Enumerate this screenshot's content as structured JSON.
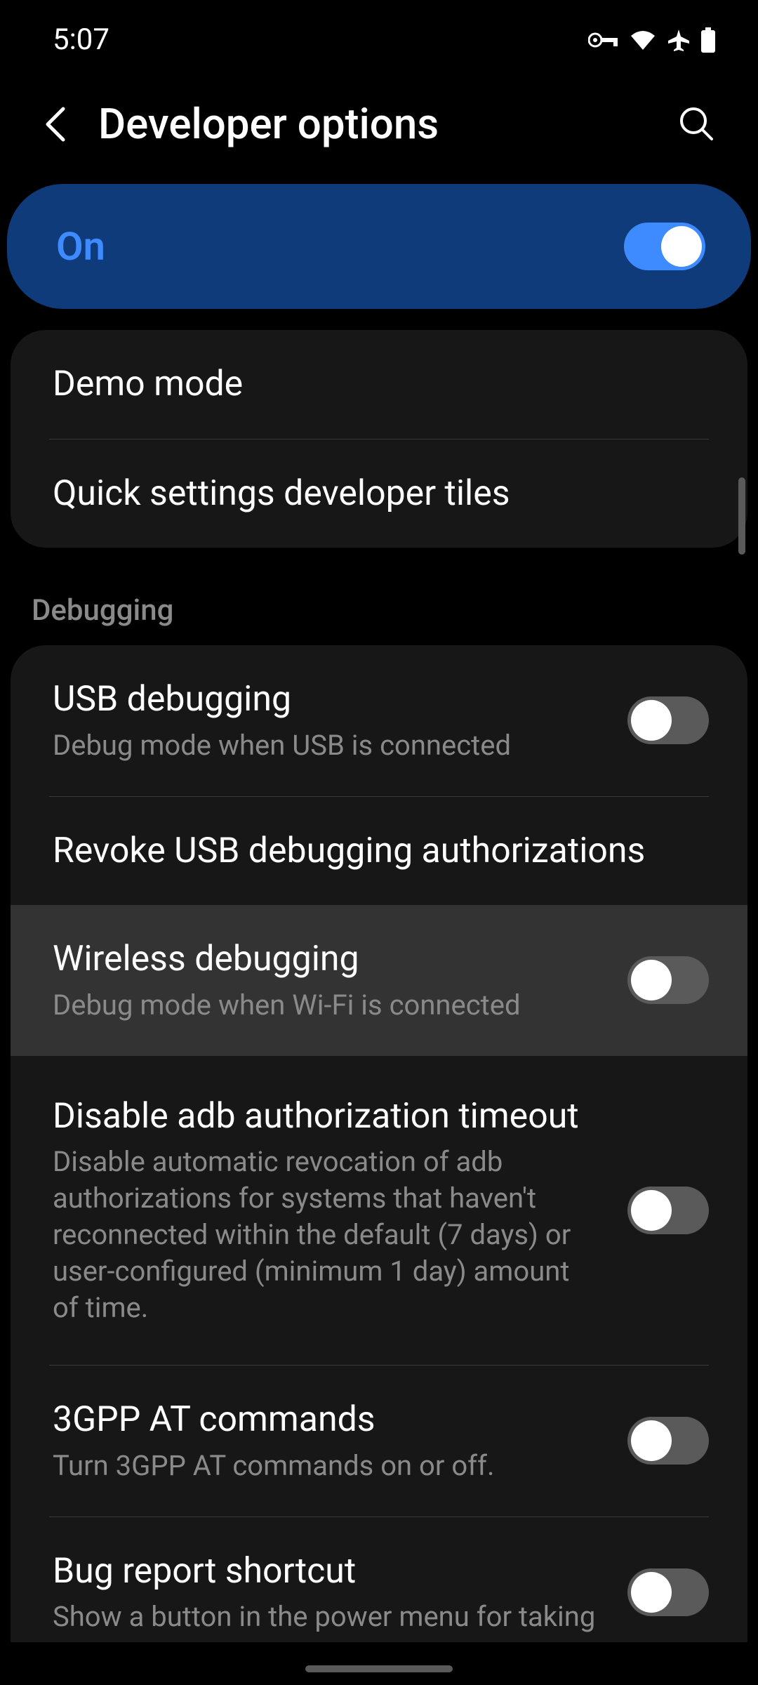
{
  "status": {
    "time": "5:07"
  },
  "header": {
    "title": "Developer options"
  },
  "master_toggle": {
    "label": "On",
    "state": true
  },
  "group1": {
    "items": [
      {
        "title": "Demo mode"
      },
      {
        "title": "Quick settings developer tiles"
      }
    ]
  },
  "section_debug": "Debugging",
  "group2": {
    "items": [
      {
        "title": "USB debugging",
        "subtitle": "Debug mode when USB is connected"
      },
      {
        "title": "Revoke USB debugging authorizations"
      },
      {
        "title": "Wireless debugging",
        "subtitle": "Debug mode when Wi-Fi is connected"
      },
      {
        "title": "Disable adb authorization timeout",
        "subtitle": "Disable automatic revocation of adb authorizations for systems that haven't reconnected within the default (7 days) or user-configured (minimum 1 day) amount of time."
      },
      {
        "title": "3GPP AT commands",
        "subtitle": "Turn 3GPP AT commands on or off."
      },
      {
        "title": "Bug report shortcut",
        "subtitle": "Show a button in the power menu for taking"
      }
    ]
  }
}
